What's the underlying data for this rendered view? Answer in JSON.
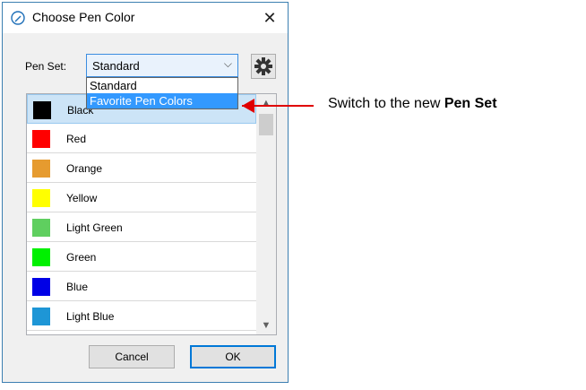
{
  "window": {
    "title": "Choose Pen Color",
    "close_glyph": "✕",
    "icon": "pen-icon"
  },
  "pen_set": {
    "label": "Pen Set:",
    "selected": "Standard",
    "options": [
      "Standard",
      "Favorite Pen Colors"
    ],
    "highlighted_option": "Favorite Pen Colors",
    "settings_icon": "gear-icon"
  },
  "colors": [
    {
      "name": "Black",
      "color": "#000000"
    },
    {
      "name": "Red",
      "color": "#ff0000"
    },
    {
      "name": "Orange",
      "color": "#e69b2f"
    },
    {
      "name": "Yellow",
      "color": "#ffff00"
    },
    {
      "name": "Light Green",
      "color": "#5fcf5f"
    },
    {
      "name": "Green",
      "color": "#00f000"
    },
    {
      "name": "Blue",
      "color": "#0000e6"
    },
    {
      "name": "Light Blue",
      "color": "#1e96d6"
    }
  ],
  "selected_color": "Black",
  "buttons": {
    "cancel": "Cancel",
    "ok": "OK"
  },
  "annotation": {
    "text_prefix": "Switch to the new ",
    "text_bold": "Pen Set",
    "arrow_color": "#e00000"
  }
}
